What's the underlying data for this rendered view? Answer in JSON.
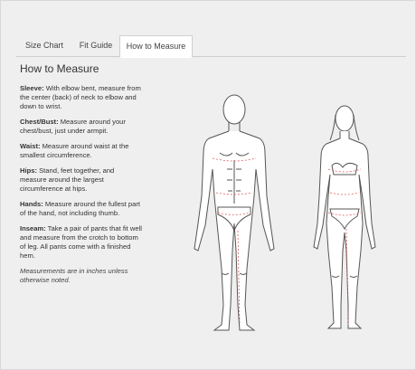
{
  "tabs": [
    {
      "label": "Size Chart",
      "active": false
    },
    {
      "label": "Fit Guide",
      "active": false
    },
    {
      "label": "How to Measure",
      "active": true
    }
  ],
  "heading": "How to Measure",
  "instructions": [
    {
      "term": "Sleeve:",
      "text": " With elbow bent, measure from the center (back) of neck to elbow and down to wrist."
    },
    {
      "term": "Chest/Bust:",
      "text": " Measure around your chest/bust, just under armpit."
    },
    {
      "term": "Waist:",
      "text": " Measure around waist at the smallest circumference."
    },
    {
      "term": "Hips:",
      "text": " Stand, feet together, and measure around the largest circumference at hips."
    },
    {
      "term": "Hands:",
      "text": " Measure around the fullest part of the hand, not including thumb."
    },
    {
      "term": "Inseam:",
      "text": " Take a pair of pants that fit well and measure from the crotch to bottom of leg. All pants come with a finished hem."
    }
  ],
  "note": "Measurements are in inches unless otherwise noted.",
  "colors": {
    "measure_line": "#e06060",
    "outline": "#555555"
  }
}
